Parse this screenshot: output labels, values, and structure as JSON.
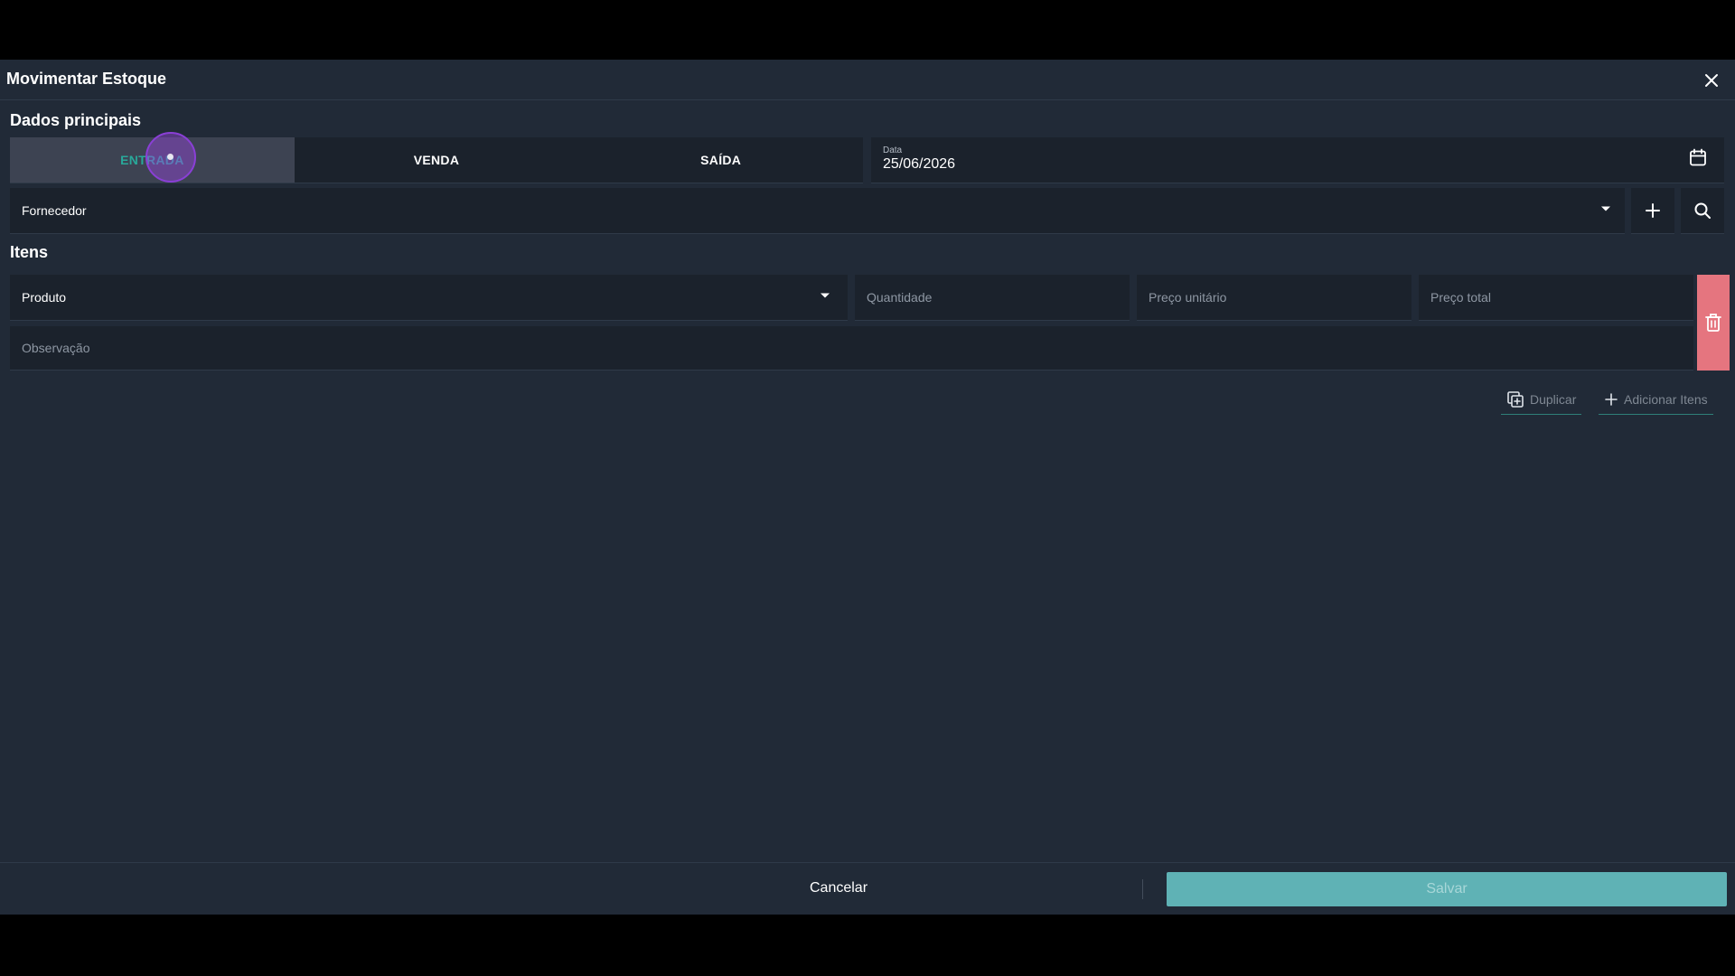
{
  "modal": {
    "title": "Movimentar Estoque"
  },
  "main_section": {
    "title": "Dados principais",
    "type_tabs": [
      "ENTRADA",
      "VENDA",
      "SAÍDA"
    ],
    "active_tab": "ENTRADA",
    "date": {
      "label": "Data",
      "value": "25/06/2026"
    },
    "supplier": {
      "placeholder": "Fornecedor"
    }
  },
  "items_section": {
    "title": "Itens",
    "product": {
      "placeholder": "Produto"
    },
    "quantity": {
      "placeholder": "Quantidade"
    },
    "unit_price": {
      "placeholder": "Preço unitário"
    },
    "total_price": {
      "placeholder": "Preço total"
    },
    "observation": {
      "placeholder": "Observação"
    },
    "duplicate_label": "Duplicar",
    "add_items_label": "Adicionar Itens"
  },
  "footer": {
    "cancel_label": "Cancelar",
    "save_label": "Salvar"
  },
  "colors": {
    "background": "#212a37",
    "field": "#1b222c",
    "active_tab_text": "#29a89a",
    "delete": "#e5757f",
    "save": "#5fb2b5"
  },
  "icons": [
    "close-icon",
    "calendar-icon",
    "chevron-down-icon",
    "plus-icon",
    "search-icon",
    "trash-icon",
    "duplicate-icon"
  ]
}
